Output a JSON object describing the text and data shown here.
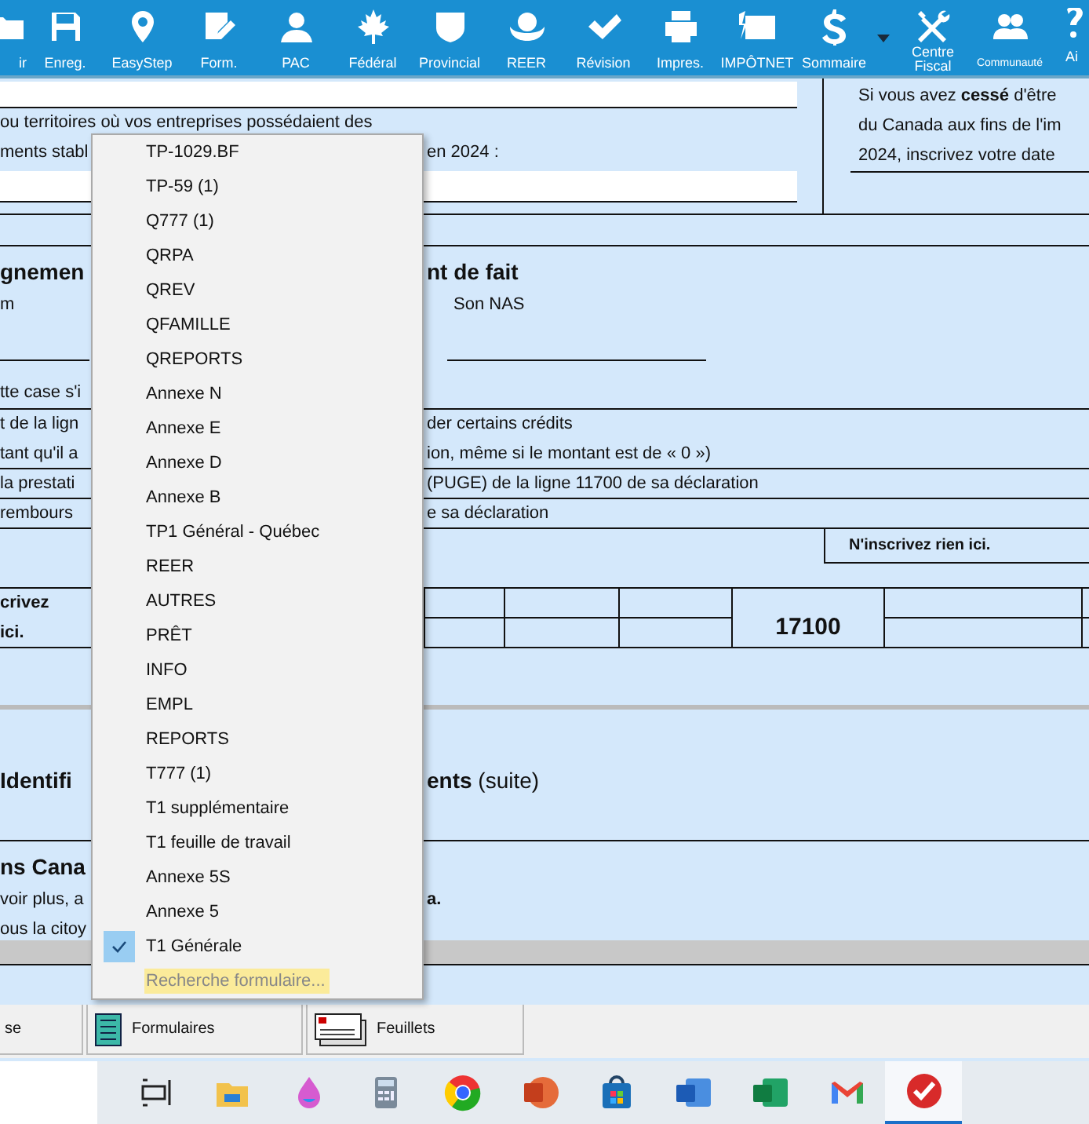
{
  "toolbar": {
    "items": [
      {
        "label": "ir"
      },
      {
        "label": "Enreg."
      },
      {
        "label": "EasyStep"
      },
      {
        "label": "Form."
      },
      {
        "label": "PAC"
      },
      {
        "label": "Fédéral"
      },
      {
        "label": "Provincial"
      },
      {
        "label": "REER"
      },
      {
        "label": "Révision"
      },
      {
        "label": "Impres."
      },
      {
        "label": "IMPÔTNET"
      },
      {
        "label": "Sommaire"
      },
      {
        "label": "Centre Fiscal"
      },
      {
        "label": "Communauté"
      },
      {
        "label": "Ai"
      }
    ]
  },
  "form": {
    "business": {
      "line_1": "ou territoires où vos entreprises possédaient des",
      "line_2_left": "ments stabl",
      "line_2_right": "en 2024 :"
    },
    "residency": {
      "lines": [
        "Si vous avez **cessé** d'être",
        "du Canada aux fins de l'im",
        "2024, inscrivez votre date"
      ]
    },
    "spouse": {
      "heading_left": "gnemen",
      "heading_right": "nt de fait",
      "label_left": "m",
      "label_right": "Son NAS",
      "checkbox_text": "tte case s'i"
    },
    "lines": [
      {
        "left": "t de la lign",
        "right": "der certains crédits",
        "divider_below": false
      },
      {
        "left": "tant qu'il a",
        "right": "ion, même si le montant est de « 0 »)",
        "divider_below": true
      },
      {
        "left": "la prestati",
        "right": "(PUGE) de la ligne 11700 de sa déclaration",
        "divider_below": true
      },
      {
        "left": "rembours",
        "right": "e sa déclaration",
        "divider_below": true
      }
    ],
    "notice": "N'inscrivez rien ici.",
    "grid": {
      "left_lines": [
        "crivez",
        "ici."
      ],
      "code": "17100"
    },
    "identification": {
      "heading_left": "Identifi",
      "heading_right": "**ents** (suite)"
    },
    "citizenship": {
      "heading": "ns Cana",
      "line_1_left": "voir plus, a",
      "line_1_right": "a.",
      "line_2": "ous la citoy"
    }
  },
  "menu": {
    "items": [
      {
        "label": "TP-1029.BF",
        "kind": "form",
        "checked": false,
        "highlighted": false
      },
      {
        "label": "TP-59 (1)",
        "kind": "form",
        "checked": false,
        "highlighted": false
      },
      {
        "label": "Q777 (1)",
        "kind": "form",
        "checked": false,
        "highlighted": false
      },
      {
        "label": "QRPA",
        "kind": "form",
        "checked": false,
        "highlighted": false
      },
      {
        "label": "QREV",
        "kind": "form",
        "checked": false,
        "highlighted": false
      },
      {
        "label": "QFAMILLE",
        "kind": "form",
        "checked": false,
        "highlighted": false
      },
      {
        "label": "QREPORTS",
        "kind": "form",
        "checked": false,
        "highlighted": false
      },
      {
        "label": "Annexe N",
        "kind": "form",
        "checked": false,
        "highlighted": false
      },
      {
        "label": "Annexe E",
        "kind": "form",
        "checked": false,
        "highlighted": false
      },
      {
        "label": "Annexe D",
        "kind": "form",
        "checked": false,
        "highlighted": false
      },
      {
        "label": "Annexe B",
        "kind": "form",
        "checked": false,
        "highlighted": false
      },
      {
        "label": "TP1 Général - Québec",
        "kind": "form",
        "checked": false,
        "highlighted": false
      },
      {
        "label": "REER",
        "kind": "form",
        "checked": false,
        "highlighted": false
      },
      {
        "label": "AUTRES",
        "kind": "form",
        "checked": false,
        "highlighted": false
      },
      {
        "label": "PRÊT",
        "kind": "form",
        "checked": false,
        "highlighted": false
      },
      {
        "label": "INFO",
        "kind": "form",
        "checked": false,
        "highlighted": false
      },
      {
        "label": "EMPL",
        "kind": "form",
        "checked": false,
        "highlighted": false
      },
      {
        "label": "REPORTS",
        "kind": "form",
        "checked": false,
        "highlighted": false
      },
      {
        "label": "T777 (1)",
        "kind": "form",
        "checked": false,
        "highlighted": false
      },
      {
        "label": "T1 supplémentaire",
        "kind": "form",
        "checked": false,
        "highlighted": false
      },
      {
        "label": "T1 feuille de travail",
        "kind": "form",
        "checked": false,
        "highlighted": false
      },
      {
        "label": "Annexe 5S",
        "kind": "form",
        "checked": false,
        "highlighted": false
      },
      {
        "label": "Annexe 5",
        "kind": "form",
        "checked": false,
        "highlighted": false
      },
      {
        "label": "T1 Générale",
        "kind": "form",
        "checked": true,
        "highlighted": false
      },
      {
        "label": "Recherche formulaire...",
        "kind": "action",
        "checked": false,
        "highlighted": true
      }
    ]
  },
  "bottom_tabs": [
    {
      "label": "se"
    },
    {
      "label": "Formulaires"
    },
    {
      "label": "Feuillets"
    }
  ],
  "taskbar": {
    "apps": [
      {
        "active": false
      },
      {
        "active": false
      },
      {
        "active": false
      },
      {
        "active": false
      },
      {
        "active": false
      },
      {
        "active": false
      },
      {
        "active": false
      },
      {
        "active": false
      },
      {
        "active": false
      },
      {
        "active": false
      },
      {
        "active": true
      }
    ]
  }
}
